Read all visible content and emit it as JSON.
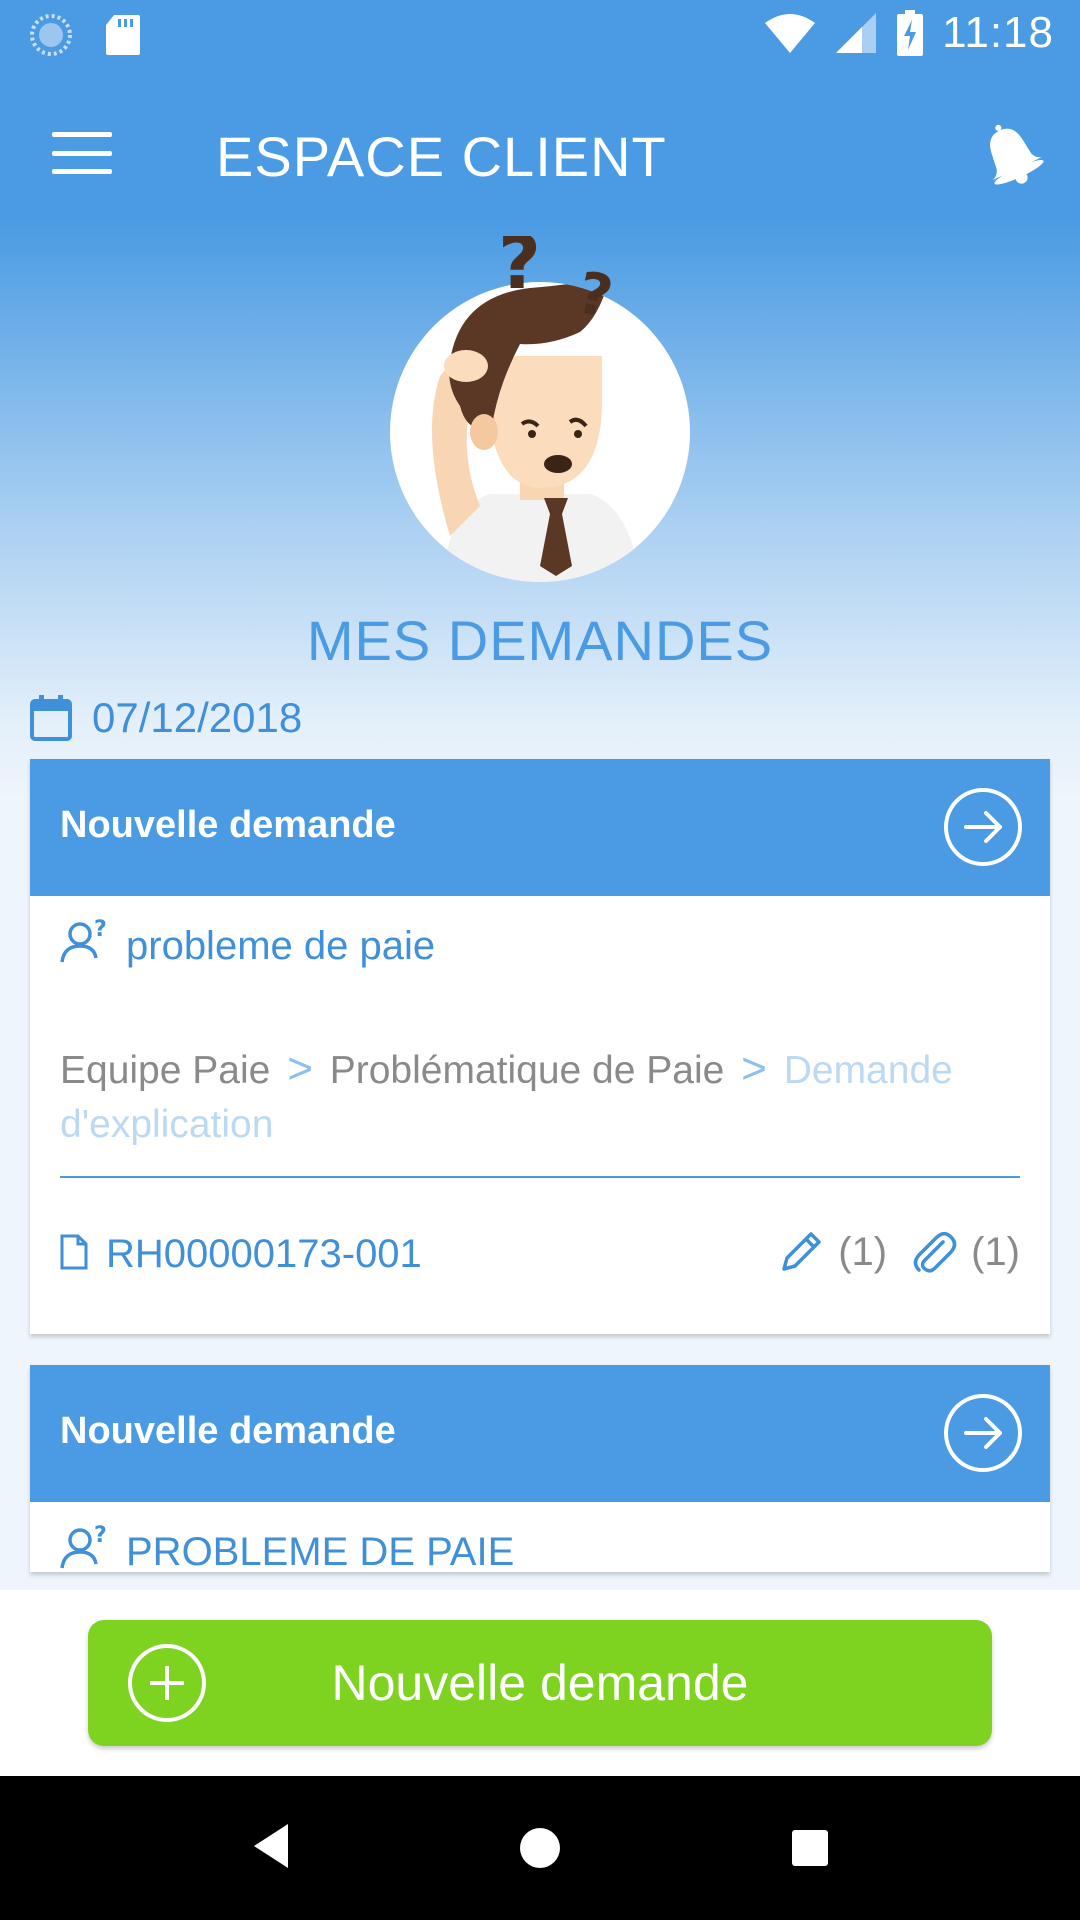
{
  "status_bar": {
    "time": "11:18"
  },
  "app_bar": {
    "title": "ESPACE CLIENT"
  },
  "page": {
    "title": "MES DEMANDES",
    "date": "07/12/2018"
  },
  "cards": [
    {
      "status": "Nouvelle demande",
      "subject": "probleme de paie",
      "path": [
        "Equipe Paie",
        "Problématique de Paie",
        "Demande d'explication"
      ],
      "path_separator": ">",
      "reference": "RH00000173-001",
      "comments_count": "(1)",
      "attachments_count": "(1)"
    },
    {
      "status": "Nouvelle demande",
      "subject": "PROBLEME DE PAIE"
    }
  ],
  "actions": {
    "new_request_label": "Nouvelle demande"
  },
  "colors": {
    "primary": "#4a9be3",
    "accent_green": "#7ed321",
    "text_blue": "#3f8fd9",
    "text_grey": "#8a8a8a"
  },
  "icons": [
    "sync-icon",
    "sd-card-icon",
    "wifi-icon",
    "signal-icon",
    "battery-charging-icon",
    "menu-icon",
    "bell-icon",
    "calendar-icon",
    "user-question-icon",
    "arrow-right-circle-icon",
    "document-icon",
    "pencil-icon",
    "paperclip-icon",
    "plus-circle-icon",
    "back-icon",
    "home-icon",
    "recents-icon"
  ]
}
